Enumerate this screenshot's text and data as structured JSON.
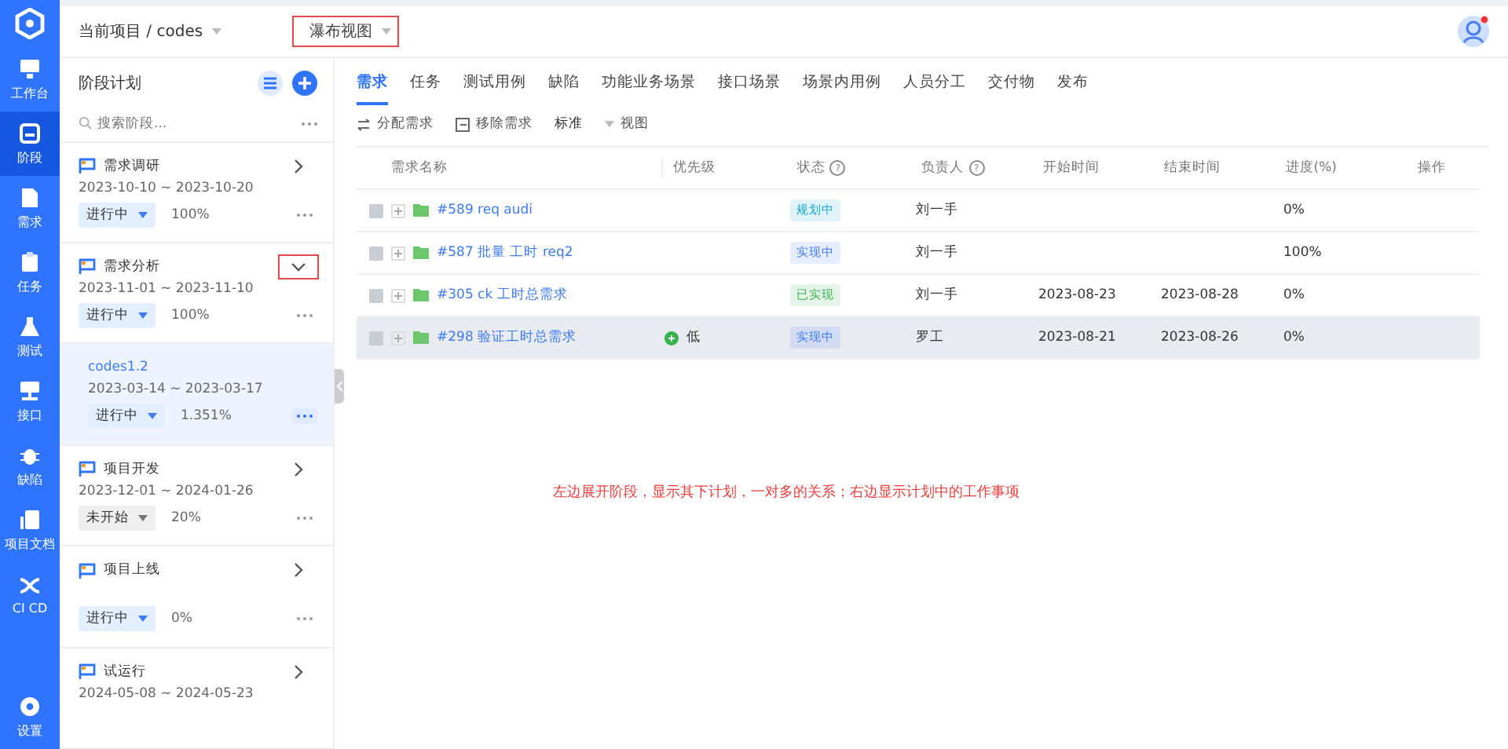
{
  "nav": {
    "items": [
      {
        "label": "工作台",
        "selected": false
      },
      {
        "label": "阶段",
        "selected": true
      },
      {
        "label": "需求",
        "selected": false
      },
      {
        "label": "任务",
        "selected": false
      },
      {
        "label": "测试",
        "selected": false
      },
      {
        "label": "接口",
        "selected": false
      },
      {
        "label": "缺陷",
        "selected": false
      },
      {
        "label": "项目文档",
        "selected": false
      },
      {
        "label": "CI CD",
        "selected": false
      }
    ],
    "bottom": {
      "label": "设置",
      "selected": false
    }
  },
  "header": {
    "breadcrumb": "当前项目 / codes",
    "view": {
      "label": "瀑布视图",
      "annotated": true
    }
  },
  "stages": {
    "title": "阶段计划",
    "search_placeholder": "搜索阶段...",
    "items": [
      {
        "name": "需求调研",
        "dates": "2023-10-10 ~ 2023-10-20",
        "status": "进行中",
        "active": true,
        "progress": "100%",
        "expanded": false,
        "annotated": false
      },
      {
        "name": "需求分析",
        "dates": "2023-11-01 ~ 2023-11-10",
        "status": "进行中",
        "active": true,
        "progress": "100%",
        "expanded": true,
        "annotated": true,
        "children": [
          {
            "name": "codes1.2",
            "dates": "2023-03-14 ~ 2023-03-17",
            "status": "进行中",
            "active": true,
            "progress": "1.351%",
            "selected": true
          }
        ]
      },
      {
        "name": "项目开发",
        "dates": "2023-12-01 ~ 2024-01-26",
        "status": "未开始",
        "active": false,
        "progress": "20%",
        "expanded": false,
        "annotated": false
      },
      {
        "name": "项目上线",
        "status": "进行中",
        "active": true,
        "progress": "0%",
        "expanded": false,
        "annotated": false
      },
      {
        "name": "试运行",
        "dates": "2024-05-08 ~ 2024-05-23",
        "expanded": false,
        "annotated": false
      }
    ]
  },
  "tabs": [
    {
      "label": "需求",
      "selected": true
    },
    {
      "label": "任务",
      "selected": false
    },
    {
      "label": "测试用例",
      "selected": false
    },
    {
      "label": "缺陷",
      "selected": false
    },
    {
      "label": "功能业务场景",
      "selected": false
    },
    {
      "label": "接口场景",
      "selected": false
    },
    {
      "label": "场景内用例",
      "selected": false
    },
    {
      "label": "人员分工",
      "selected": false
    },
    {
      "label": "交付物",
      "selected": false
    },
    {
      "label": "发布",
      "selected": false
    }
  ],
  "toolbar": [
    {
      "kind": "assign",
      "label": "分配需求"
    },
    {
      "kind": "remove",
      "label": "移除需求"
    },
    {
      "kind": "plain",
      "label": "标准"
    },
    {
      "kind": "dropdown",
      "label": "视图"
    }
  ],
  "table": {
    "columns": [
      {
        "label": "需求名称"
      },
      {
        "label": "优先级"
      },
      {
        "label": "状态",
        "help": "?"
      },
      {
        "label": "负责人",
        "help": "?"
      },
      {
        "label": "开始时间"
      },
      {
        "label": "结束时间"
      },
      {
        "label": "进度(%)"
      },
      {
        "label": "操作"
      }
    ],
    "rows": [
      {
        "name": "#589 req audi",
        "status": "规划中",
        "color": "#13a8c9",
        "owner": "刘一手",
        "progress": "0%",
        "selected": false
      },
      {
        "name": "#587 批量 工时 req2",
        "status": "实现中",
        "color": "#3d7bf5",
        "owner": "刘一手",
        "progress": "100%",
        "selected": false
      },
      {
        "name": "#305 ck 工时总需求",
        "status": "已实现",
        "color": "#37b24d",
        "owner": "刘一手",
        "start": "2023-08-23",
        "end": "2023-08-28",
        "progress": "0%",
        "selected": false
      },
      {
        "name": "#298 验证工时总需求",
        "priority": "低",
        "status": "实现中",
        "color": "#3d7bf5",
        "owner": "罗工",
        "start": "2023-08-21",
        "end": "2023-08-26",
        "progress": "0%",
        "selected": true
      }
    ]
  },
  "note": "左边展开阶段，显示其下计划，一对多的关系；右边显示计划中的工作事项"
}
